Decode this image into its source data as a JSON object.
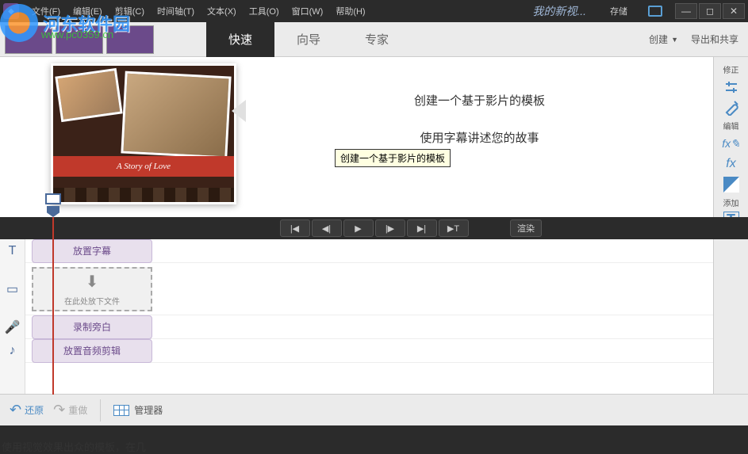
{
  "menubar": {
    "items": [
      "文件(F)",
      "编辑(E)",
      "剪辑(C)",
      "时间轴(T)",
      "文本(X)",
      "工具(O)",
      "窗口(W)",
      "帮助(H)"
    ],
    "project_name": "我的新视...",
    "save": "存储"
  },
  "mode_tabs": {
    "quick": "快速",
    "guided": "向导",
    "expert": "专家"
  },
  "mode_right": {
    "create": "创建",
    "export": "导出和共享"
  },
  "templates": {
    "ribbon": "A Story of Love",
    "item1": "创建一个基于影片的模板",
    "tooltip": "创建一个基于影片的模板",
    "item2": "使用字幕讲述您的故事",
    "desc_prefix": "使用视觉效果出众的模板，在几"
  },
  "right_panel": {
    "fix": "修正",
    "edit": "编辑",
    "add": "添加"
  },
  "playback": {
    "render": "渲染"
  },
  "timeline": {
    "title_track": "放置字幕",
    "drop_hint": "在此处放下文件",
    "narration": "录制旁白",
    "audio": "放置音频剪辑"
  },
  "bottom": {
    "undo": "还原",
    "redo": "重做",
    "organizer": "管理器"
  },
  "watermark": {
    "text": "河东软件园",
    "url": "www.pc0359.cn"
  }
}
